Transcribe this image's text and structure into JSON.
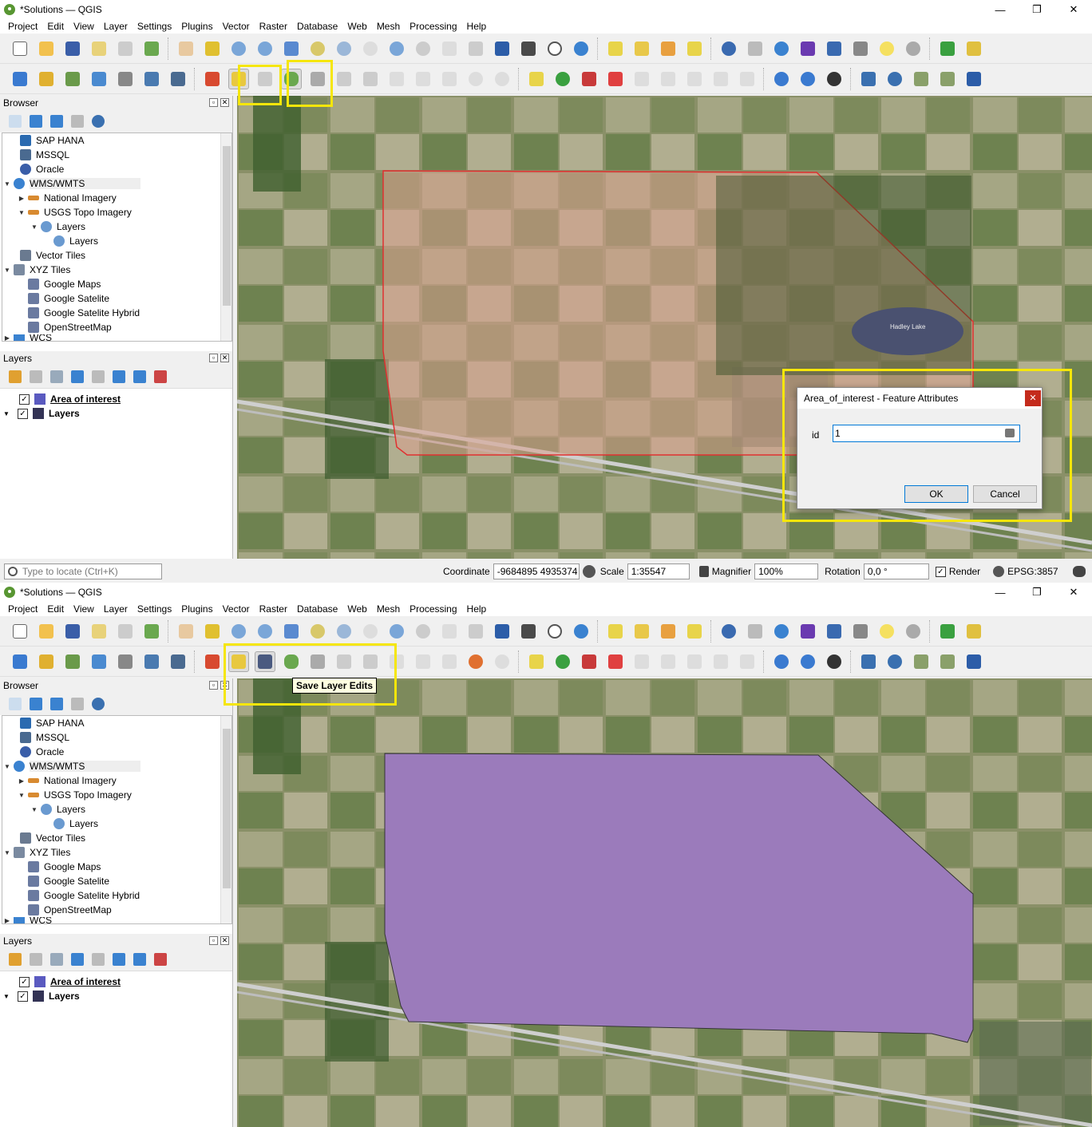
{
  "window": {
    "title": "*Solutions — QGIS"
  },
  "menu": [
    "Project",
    "Edit",
    "View",
    "Layer",
    "Settings",
    "Plugins",
    "Vector",
    "Raster",
    "Database",
    "Web",
    "Mesh",
    "Processing",
    "Help"
  ],
  "browser": {
    "title": "Browser",
    "items": [
      {
        "label": "SAP HANA",
        "icon": "sap-hana-icon"
      },
      {
        "label": "MSSQL",
        "icon": "mssql-icon"
      },
      {
        "label": "Oracle",
        "icon": "oracle-icon"
      },
      {
        "label": "WMS/WMTS",
        "icon": "wms-globe-icon"
      },
      {
        "label": "National Imagery",
        "icon": "wms-server-icon"
      },
      {
        "label": "USGS Topo Imagery",
        "icon": "wms-server-icon"
      },
      {
        "label": "Layers",
        "icon": "globe-icon"
      },
      {
        "label": "Layers",
        "icon": "globe-icon"
      },
      {
        "label": "Vector Tiles",
        "icon": "vector-tiles-icon"
      },
      {
        "label": "XYZ Tiles",
        "icon": "xyz-tiles-icon"
      },
      {
        "label": "Google Maps",
        "icon": "tile-grid-icon"
      },
      {
        "label": "Google Satelite",
        "icon": "tile-grid-icon"
      },
      {
        "label": "Google Satelite Hybrid",
        "icon": "tile-grid-icon"
      },
      {
        "label": "OpenStreetMap",
        "icon": "tile-grid-icon"
      },
      {
        "label": "WCS",
        "icon": "wcs-icon"
      }
    ]
  },
  "layers": {
    "title": "Layers",
    "items": [
      {
        "label": "Area of interest",
        "checked": true,
        "icon": "polygon-layer-icon"
      },
      {
        "label": "Layers",
        "checked": true,
        "icon": "raster-layer-icon"
      }
    ]
  },
  "status": {
    "locate_placeholder": "Type to locate (Ctrl+K)",
    "coordinate_label": "Coordinate",
    "coordinate_value": "-9684895 4935374",
    "scale_label": "Scale",
    "scale_value": "1:35547",
    "magnifier_label": "Magnifier",
    "magnifier_value": "100%",
    "rotation_label": "Rotation",
    "rotation_value": "0,0 °",
    "render_label": "Render",
    "crs": "EPSG:3857"
  },
  "dialog": {
    "title": "Area_of_interest - Feature Attributes",
    "field_label": "id",
    "field_value": "1",
    "ok_label": "OK",
    "cancel_label": "Cancel"
  },
  "tooltip": {
    "text": "Save Layer Edits"
  },
  "map_labels": {
    "lake": "Hadley Lake"
  },
  "colors": {
    "highlight": "#f5e60a",
    "polygon_fill": "#9b7bbb",
    "edit_outline": "#e03030"
  }
}
